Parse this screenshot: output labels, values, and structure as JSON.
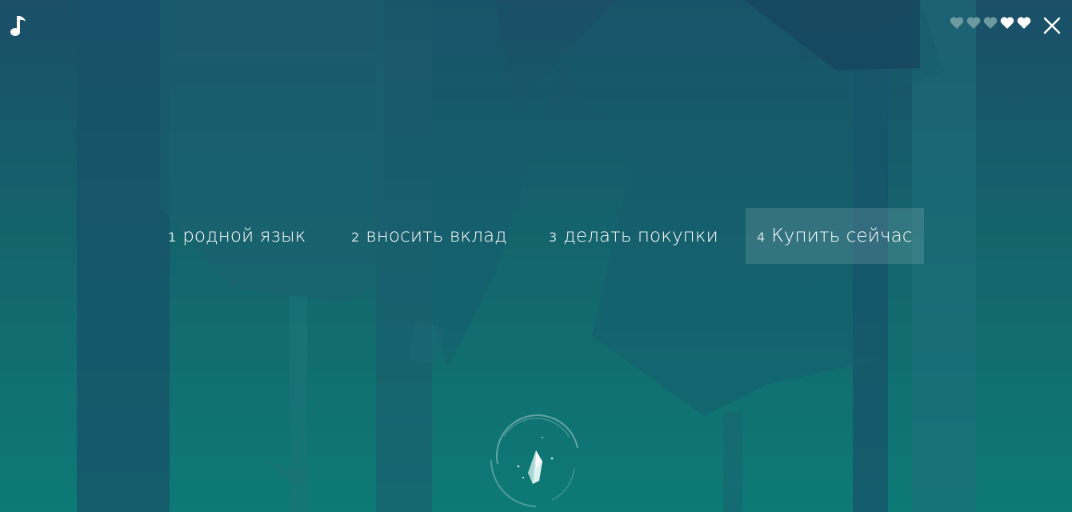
{
  "controls": {
    "music_icon": "music-note-icon",
    "close_icon": "close-icon"
  },
  "lives": {
    "total": 5,
    "remaining": 2,
    "icon": "heart-icon",
    "full_color": "#ffffff",
    "empty_color": "#6c9aa0"
  },
  "answers": [
    {
      "number": "1",
      "text": "родной язык",
      "selected": false
    },
    {
      "number": "2",
      "text": "вносить вклад",
      "selected": false
    },
    {
      "number": "3",
      "text": "делать покупки",
      "selected": false
    },
    {
      "number": "4",
      "text": "Купить сейчас",
      "selected": true
    }
  ],
  "timer": {
    "icon": "crystal-icon"
  },
  "colors": {
    "sky_top": "#1a4f67",
    "ground": "#0d7a76",
    "text": "#ffffff"
  }
}
